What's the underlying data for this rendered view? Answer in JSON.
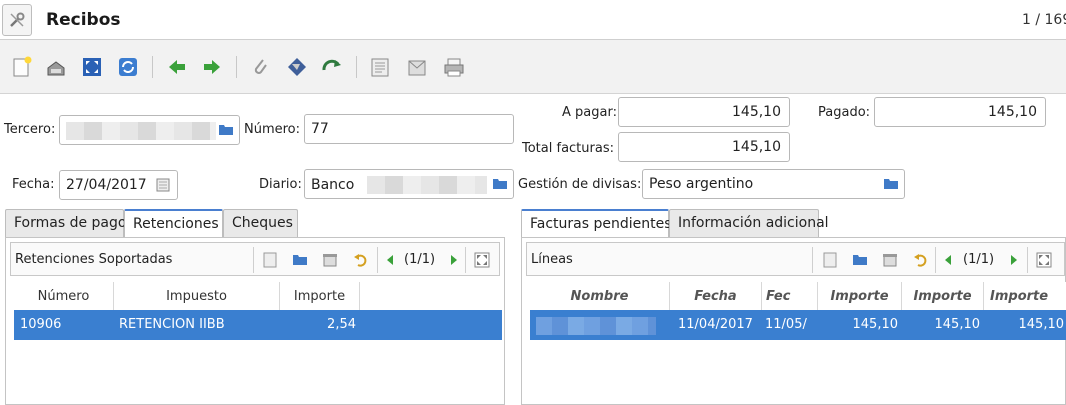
{
  "window": {
    "title": "Recibos",
    "record_counter": "1 / 169"
  },
  "form": {
    "tercero_label": "Tercero:",
    "numero_label": "Número:",
    "numero_value": "77",
    "fecha_label": "Fecha:",
    "fecha_value": "27/04/2017",
    "diario_label": "Diario:",
    "diario_value": "Banco",
    "a_pagar_label": "A pagar:",
    "a_pagar_value": "145,10",
    "pagado_label": "Pagado:",
    "pagado_value": "145,10",
    "total_facturas_label": "Total facturas:",
    "total_facturas_value": "145,10",
    "gestion_label": "Gestión de divisas:",
    "gestion_value": "Peso argentino"
  },
  "left_tabs": [
    "Formas de pago",
    "Retenciones",
    "Cheques"
  ],
  "left_panel": {
    "title": "Retenciones Soportadas",
    "pager": "(1/1)",
    "columns": [
      "Número",
      "Impuesto",
      "Importe"
    ],
    "row": {
      "numero": "10906",
      "impuesto": "RETENCION IIBB",
      "importe": "2,54"
    }
  },
  "right_tabs": [
    "Facturas pendientes",
    "Información adicional"
  ],
  "right_panel": {
    "title": "Líneas",
    "pager": "(1/1)",
    "columns": [
      "Nombre",
      "Fecha",
      "Fec",
      "Importe",
      "Importe",
      "Importe"
    ],
    "row": {
      "fecha": "11/04/2017",
      "fec": "11/05/",
      "importe1": "145,10",
      "importe2": "145,10",
      "importe3": "145,10"
    }
  },
  "icons": [
    "tools-icon",
    "new-icon",
    "save-icon",
    "fullscreen-icon",
    "reload-icon",
    "previous-icon",
    "next-icon",
    "attach-icon",
    "action-icon",
    "relate-icon",
    "report-icon",
    "email-icon",
    "print-icon"
  ],
  "colors": {
    "selection": "#3a7fd0",
    "arrow_green": "#3aa13a",
    "tab_accent": "#4a7fd0"
  }
}
